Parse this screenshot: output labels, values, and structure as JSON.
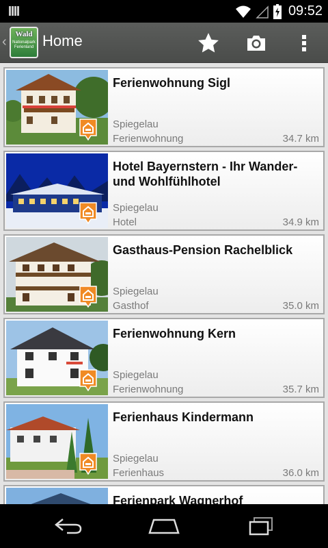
{
  "status_bar": {
    "time": "09:52"
  },
  "action_bar": {
    "title": "Home",
    "logo": {
      "line1": "Wald",
      "line2": "Nationalpark Ferienland"
    },
    "favorites_icon": "star-icon",
    "camera_icon": "camera-icon",
    "overflow_icon": "overflow-menu-icon"
  },
  "listings": [
    {
      "name": "Ferienwohnung Sigl",
      "city": "Spiegelau",
      "type": "Ferienwohnung",
      "distance": "34.7 km"
    },
    {
      "name": "Hotel Bayernstern - Ihr Wander- und Wohlfühlhotel",
      "city": "Spiegelau",
      "type": "Hotel",
      "distance": "34.9 km"
    },
    {
      "name": "Gasthaus-Pension Rachelblick",
      "city": "Spiegelau",
      "type": "Gasthof",
      "distance": "35.0 km"
    },
    {
      "name": "Ferienwohnung Kern",
      "city": "Spiegelau",
      "type": "Ferienwohnung",
      "distance": "35.7 km"
    },
    {
      "name": "Ferienhaus Kindermann",
      "city": "Spiegelau",
      "type": "Ferienhaus",
      "distance": "36.0 km"
    },
    {
      "name": "Ferienpark Wagnerhof",
      "city": "",
      "type": "",
      "distance": ""
    }
  ],
  "colors": {
    "pin": "#f08a24",
    "action_bar": "#555755",
    "list_bg": "#e3e3e3"
  }
}
